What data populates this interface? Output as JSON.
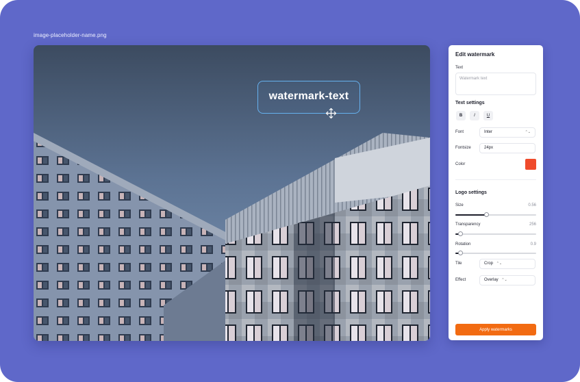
{
  "colors": {
    "background": "#5f68c9",
    "accent": "#f26b12",
    "watermark_color": "#ef4b2c",
    "selection_border": "#66b1ef"
  },
  "canvas": {
    "file_name": "image-placeholder-name.png",
    "watermark_text": "watermark-text",
    "move_icon": "move-arrows-icon"
  },
  "panel": {
    "title": "Edit watermark",
    "text_label": "Text",
    "text_placeholder": "Watermark text",
    "text_value": "",
    "text_settings_title": "Text settings",
    "format_buttons": [
      "B",
      "I",
      "U"
    ],
    "font_label": "Font",
    "font_value": "Inter",
    "fontsize_label": "Fontsize",
    "fontsize_value": "24px",
    "color_label": "Color",
    "logo_settings_title": "Logo settings",
    "size": {
      "label": "Size",
      "value_text": "0.56",
      "value": 0.38
    },
    "transparency": {
      "label": "Transparency",
      "value_text": "256",
      "value": 0.06
    },
    "rotation": {
      "label": "Rotation",
      "value_text": "0.9",
      "value": 0.06
    },
    "tile": {
      "label": "Tile",
      "value": "Crop"
    },
    "effect": {
      "label": "Effect",
      "value": "Overlay"
    },
    "apply_label": "Apply watermarks"
  }
}
